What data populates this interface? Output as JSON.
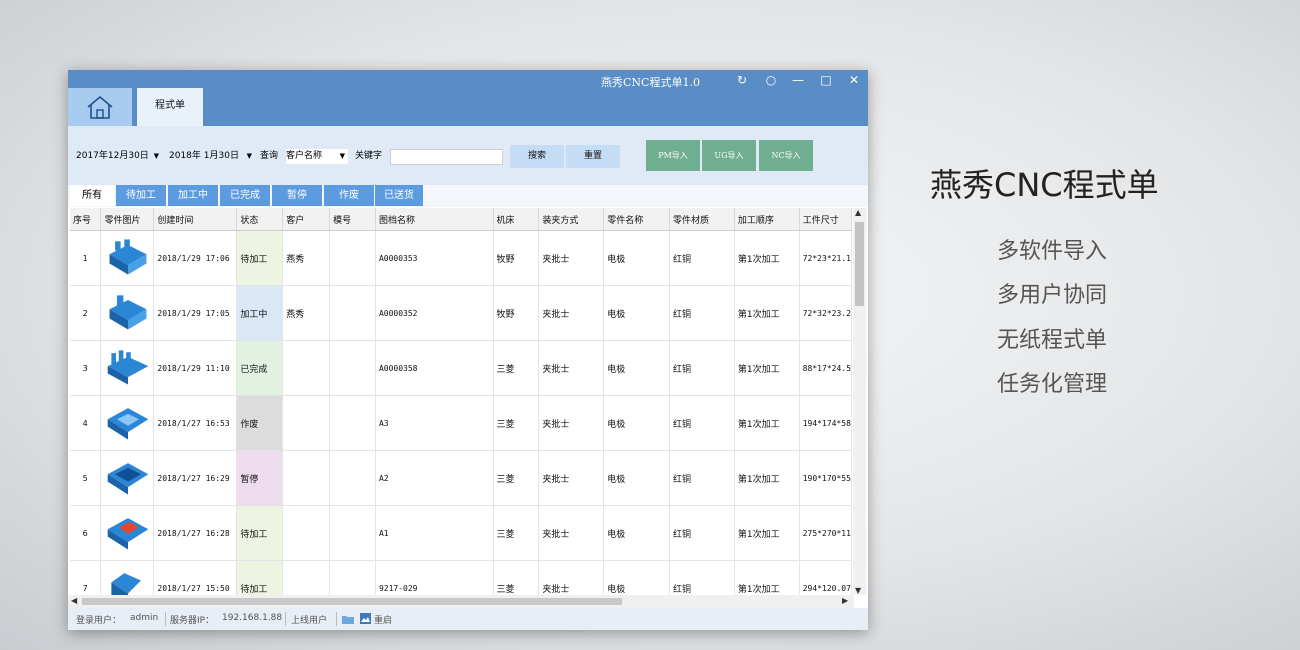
{
  "window": {
    "app_title": "燕秀CNC程式单1.0",
    "tab_label": "程式单"
  },
  "toolbar": {
    "date_from": "2017年12月30日",
    "date_to": "2018年 1月30日",
    "query_label": "查询",
    "query_field": "客户名称",
    "keyword_label": "关键字",
    "keyword_value": "",
    "search_label": "搜索",
    "reset_label": "重置",
    "pm_import": "PM导入",
    "ug_import": "UG导入",
    "nc_import": "NC导入"
  },
  "filter_tabs": [
    "所有",
    "待加工",
    "加工中",
    "已完成",
    "暂停",
    "作废",
    "已送货"
  ],
  "table": {
    "columns": [
      "序号",
      "零件图片",
      "创建时间",
      "状态",
      "客户",
      "模号",
      "图档名称",
      "机床",
      "装夹方式",
      "零件名称",
      "零件材质",
      "加工顺序",
      "工件尺寸"
    ],
    "rows": [
      {
        "no": "1",
        "time": "2018/1/29 17:06",
        "status": "待加工",
        "status_color": "#eef4e2",
        "customer": "燕秀",
        "mold": "",
        "file": "A0000353",
        "machine": "牧野",
        "clamp": "夹批士",
        "part": "电极",
        "material": "红铜",
        "order": "第1次加工",
        "size": "72*23*21.1"
      },
      {
        "no": "2",
        "time": "2018/1/29 17:05",
        "status": "加工中",
        "status_color": "#d9e7f7",
        "customer": "燕秀",
        "mold": "",
        "file": "A0000352",
        "machine": "牧野",
        "clamp": "夹批士",
        "part": "电极",
        "material": "红铜",
        "order": "第1次加工",
        "size": "72*32*23.2"
      },
      {
        "no": "3",
        "time": "2018/1/29 11:10",
        "status": "已完成",
        "status_color": "#e2f2e2",
        "customer": "",
        "mold": "",
        "file": "A0000358",
        "machine": "三菱",
        "clamp": "夹批士",
        "part": "电极",
        "material": "红铜",
        "order": "第1次加工",
        "size": "88*17*24.5"
      },
      {
        "no": "4",
        "time": "2018/1/27 16:53",
        "status": "作废",
        "status_color": "#dcdcdc",
        "customer": "",
        "mold": "",
        "file": "A3",
        "machine": "三菱",
        "clamp": "夹批士",
        "part": "电极",
        "material": "红铜",
        "order": "第1次加工",
        "size": "194*174*58"
      },
      {
        "no": "5",
        "time": "2018/1/27 16:29",
        "status": "暂停",
        "status_color": "#ecdcee",
        "customer": "",
        "mold": "",
        "file": "A2",
        "machine": "三菱",
        "clamp": "夹批士",
        "part": "电极",
        "material": "红铜",
        "order": "第1次加工",
        "size": "190*170*55"
      },
      {
        "no": "6",
        "time": "2018/1/27 16:28",
        "status": "待加工",
        "status_color": "#eef4e2",
        "customer": "",
        "mold": "",
        "file": "A1",
        "machine": "三菱",
        "clamp": "夹批士",
        "part": "电极",
        "material": "红铜",
        "order": "第1次加工",
        "size": "275*270*11"
      },
      {
        "no": "7",
        "time": "2018/1/27 15:50",
        "status": "待加工",
        "status_color": "#eef4e2",
        "customer": "",
        "mold": "",
        "file": "9217-029",
        "machine": "三菱",
        "clamp": "夹批士",
        "part": "电极",
        "material": "红铜",
        "order": "第1次加工",
        "size": "294*120.07"
      }
    ]
  },
  "statusbar": {
    "user_label": "登录用户：",
    "user": "admin",
    "server_label": "服务器IP：",
    "server": "192.168.1.88",
    "online_label": "上线用户",
    "restart_label": "重启"
  },
  "promo": {
    "title": "燕秀CNC程式单",
    "features": [
      "多软件导入",
      "多用户协同",
      "无纸程式单",
      "任务化管理"
    ]
  },
  "colors": {
    "titlebar": "#5a8dc6",
    "tab": "#5c9be0",
    "import_button": "#6fae90",
    "part_blue": "#2c86d6"
  }
}
